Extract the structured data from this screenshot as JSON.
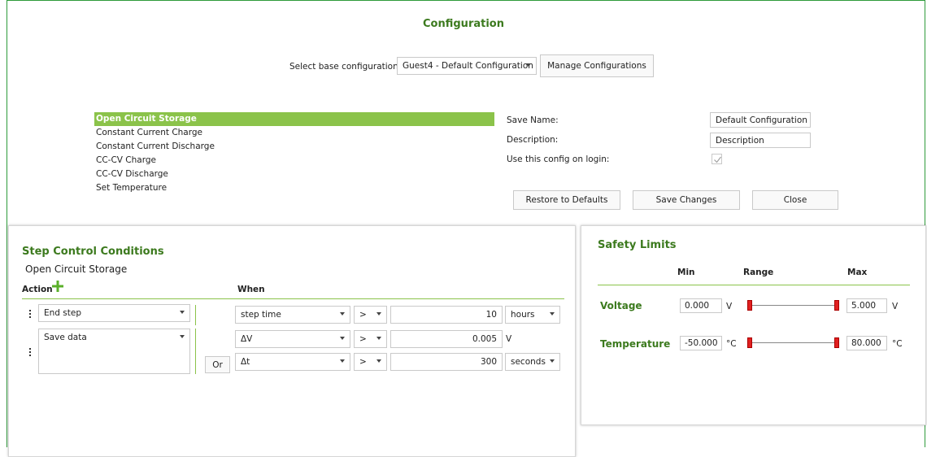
{
  "header": {
    "title": "Configuration",
    "base_config_label": "Select base configuration:",
    "base_config_value": "Guest4 - Default Configuration",
    "manage_button": "Manage Configurations"
  },
  "steps": [
    {
      "label": "Open Circuit Storage",
      "selected": true
    },
    {
      "label": "Constant Current Charge",
      "selected": false
    },
    {
      "label": "Constant Current Discharge",
      "selected": false
    },
    {
      "label": "CC-CV Charge",
      "selected": false
    },
    {
      "label": "CC-CV Discharge",
      "selected": false
    },
    {
      "label": "Set Temperature",
      "selected": false
    }
  ],
  "form": {
    "save_name_label": "Save Name:",
    "save_name_value": "Default Configuration",
    "description_label": "Description:",
    "description_value": "Description",
    "use_on_login_label": "Use this config on login:",
    "use_on_login_checked": true,
    "restore_button": "Restore to Defaults",
    "save_button": "Save Changes",
    "close_button": "Close"
  },
  "step_control": {
    "title": "Step Control Conditions",
    "subtitle": "Open Circuit Storage",
    "action_header": "Action",
    "when_header": "When",
    "or_button": "Or",
    "rows": [
      {
        "action": "End step",
        "conditions": [
          {
            "variable": "step time",
            "operator": ">",
            "value": "10",
            "unit": "hours"
          }
        ]
      },
      {
        "action": "Save data",
        "conditions": [
          {
            "variable": "ΔV",
            "operator": ">",
            "value": "0.005",
            "unit": "V"
          },
          {
            "variable": "Δt",
            "operator": ">",
            "value": "300",
            "unit": "seconds"
          }
        ]
      }
    ]
  },
  "safety": {
    "title": "Safety Limits",
    "min_header": "Min",
    "range_header": "Range",
    "max_header": "Max",
    "limits": [
      {
        "name": "Voltage",
        "min": "0.000",
        "max": "5.000",
        "unit": "V"
      },
      {
        "name": "Temperature",
        "min": "-50.000",
        "max": "80.000",
        "unit": "°C"
      }
    ]
  },
  "colors": {
    "accent_green": "#3c7a1e",
    "selection_green": "#8bc34a",
    "slider_thumb": "#e02020"
  }
}
